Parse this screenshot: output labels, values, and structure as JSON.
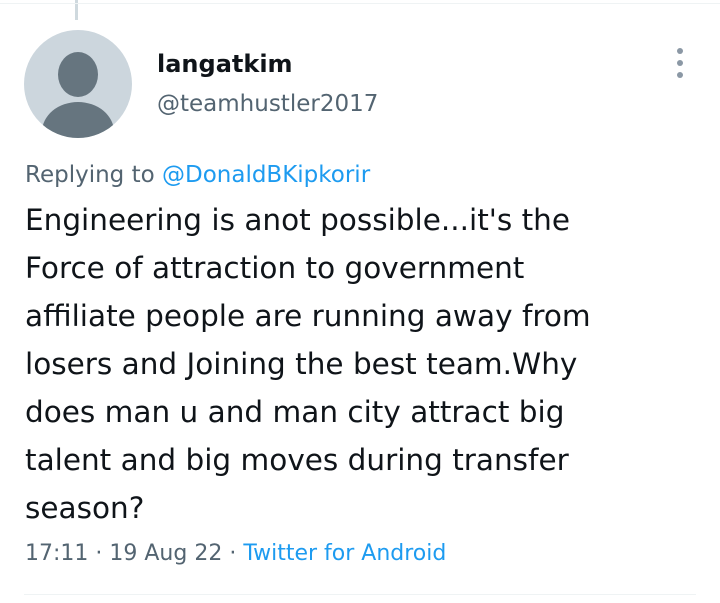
{
  "tweet": {
    "display_name": "langatkim",
    "handle": "@teamhustler2017",
    "replying_prefix": "Replying to ",
    "replying_to": "@DonaldBKipkorir",
    "text": "Engineering is anot possible...it's the\nForce of attraction to government\naffiliate people are running away from\nlosers and Joining the best team.Why\ndoes man u and man city attract big\ntalent and big moves during transfer\nseason?",
    "time": "17:11",
    "separator": " · ",
    "date": "19 Aug 22",
    "source": "Twitter for Android"
  },
  "icons": {
    "avatar": "default-profile-avatar",
    "more": "more-options-icon"
  },
  "colors": {
    "link": "#1d9bf0",
    "secondary_text": "#536471",
    "primary_text": "#0f1419",
    "avatar_bg": "#ccd6dd"
  }
}
